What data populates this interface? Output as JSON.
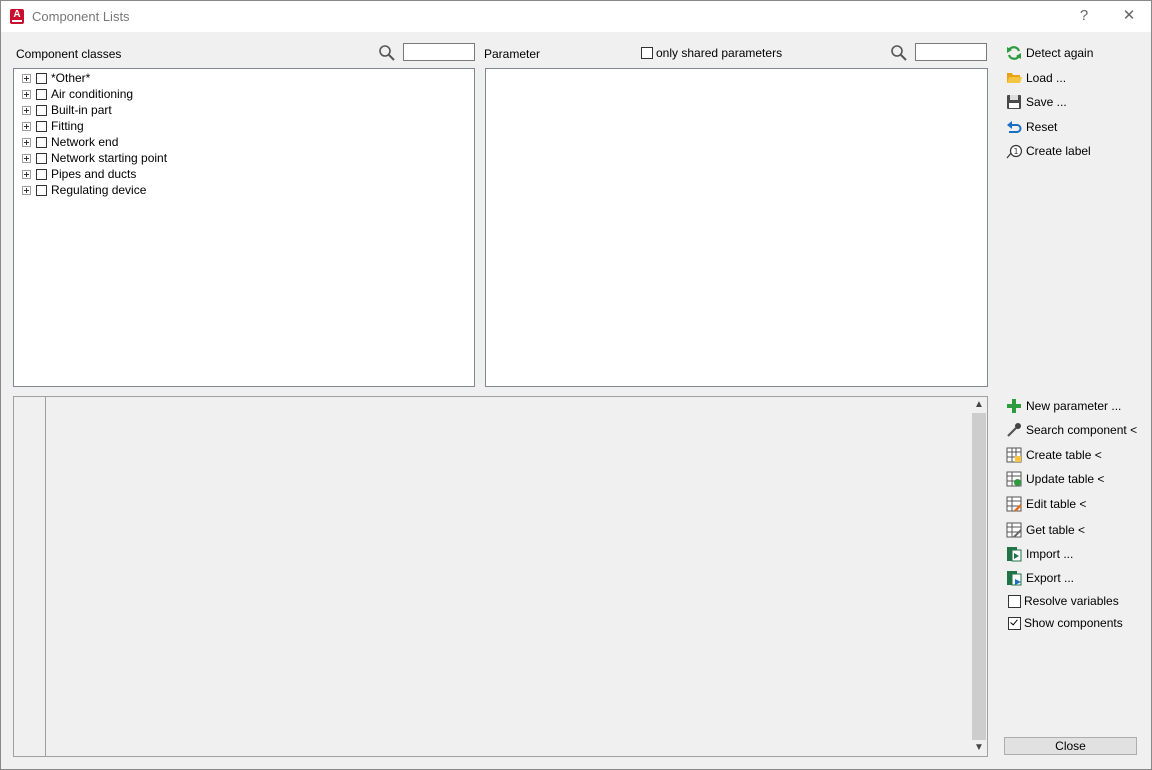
{
  "window": {
    "title": "Component Lists",
    "help": "?",
    "close": "✕"
  },
  "component_classes": {
    "label": "Component classes",
    "search_value": "",
    "items": [
      {
        "label": "*Other*",
        "checked": false
      },
      {
        "label": "Air conditioning",
        "checked": false
      },
      {
        "label": "Built-in part",
        "checked": false
      },
      {
        "label": "Fitting",
        "checked": false
      },
      {
        "label": "Network end",
        "checked": false
      },
      {
        "label": "Network starting point",
        "checked": false
      },
      {
        "label": "Pipes and ducts",
        "checked": false
      },
      {
        "label": "Regulating device",
        "checked": false
      }
    ]
  },
  "parameter": {
    "label": "Parameter",
    "only_shared_label": "only shared parameters",
    "search_value": ""
  },
  "actions_top": [
    {
      "label": "Detect again",
      "icon": "refresh-icon"
    },
    {
      "label": "Load ...",
      "icon": "folder-open-icon"
    },
    {
      "label": "Save ...",
      "icon": "save-icon"
    },
    {
      "label": "Reset",
      "icon": "undo-icon"
    },
    {
      "label": "Create label",
      "icon": "label-icon"
    }
  ],
  "actions_bottom": [
    {
      "label": "New parameter ...",
      "icon": "plus-icon"
    },
    {
      "label": "Search component <",
      "icon": "eyedropper-icon"
    },
    {
      "label": "Create table <",
      "icon": "create-table-icon"
    },
    {
      "label": "Update table <",
      "icon": "update-table-icon"
    },
    {
      "label": "Edit table <",
      "icon": "edit-table-icon"
    },
    {
      "label": "Get table <",
      "icon": "get-table-icon"
    },
    {
      "label": "Import ...",
      "icon": "import-icon"
    },
    {
      "label": "Export ...",
      "icon": "export-icon"
    }
  ],
  "options": {
    "resolve_variables": {
      "label": "Resolve variables",
      "checked": false
    },
    "show_components": {
      "label": "Show components",
      "checked": true
    }
  },
  "close_label": "Close"
}
